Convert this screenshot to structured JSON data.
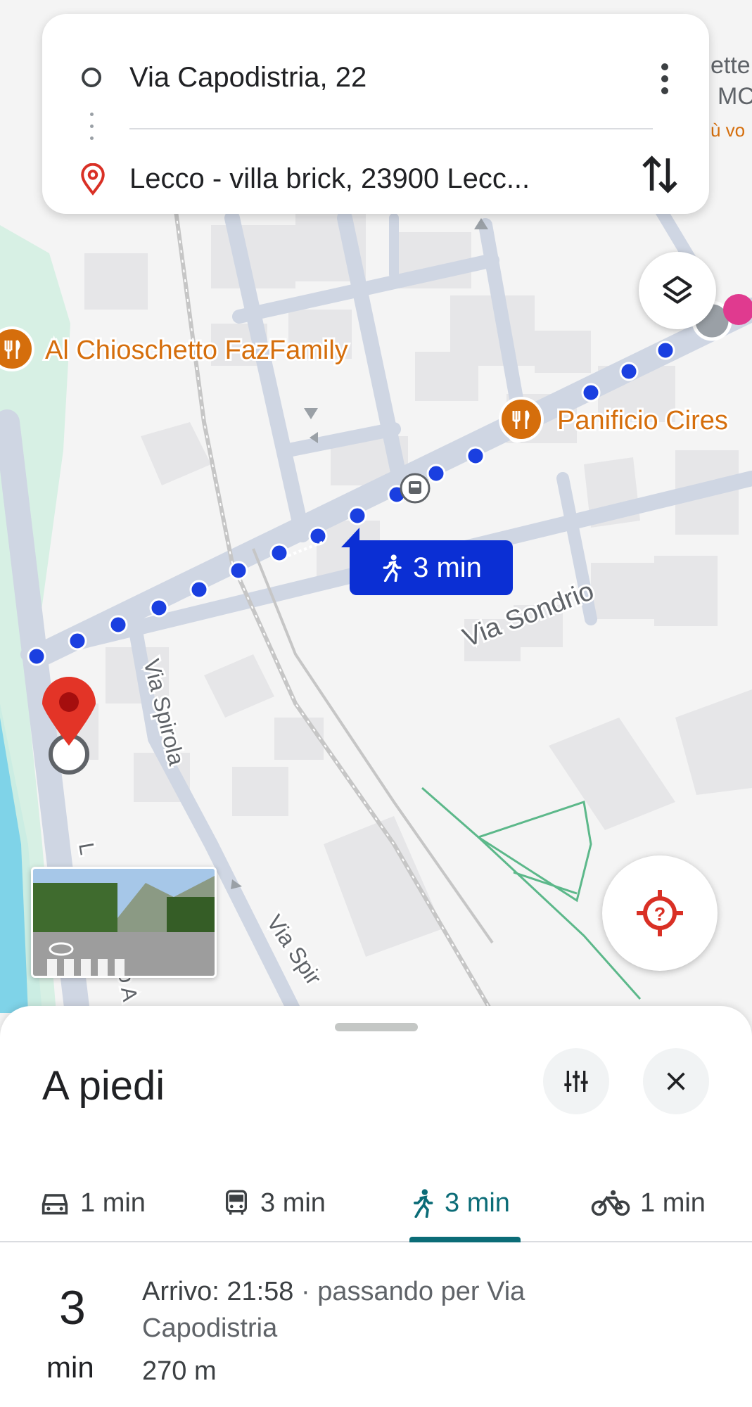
{
  "search": {
    "origin": "Via Capodistria, 22",
    "destination": "Lecco - villa brick, 23900 Lecc..."
  },
  "map": {
    "poi_chioschetto": "Al Chioschetto FazFamily",
    "poi_panificio": "Panificio Cires",
    "street_sondrio": "Via Sondrio",
    "street_spirola": "Via Spirola",
    "street_spirola_lower": "Via Spir",
    "corner_top_right": [
      "ette",
      "MC",
      "ù vo"
    ],
    "corner_left": "L",
    "corner_bottom_left": "o A",
    "route_duration": "3 min",
    "colors": {
      "route": "#1a3fe0",
      "bubble": "#0b2fd4",
      "poi": "#d56e0c",
      "pin": "#e33427",
      "park": "#d4f0e2",
      "water": "#7fd3e8"
    }
  },
  "sheet": {
    "title": "A piedi",
    "modes": [
      {
        "icon": "car-icon",
        "label": "1 min"
      },
      {
        "icon": "transit-icon",
        "label": "3 min"
      },
      {
        "icon": "walk-icon",
        "label": "3 min",
        "active": true
      },
      {
        "icon": "bike-icon",
        "label": "1 min"
      }
    ],
    "duration_value": "3",
    "duration_unit": "min",
    "arrival_text": "Arrivo: 21:58",
    "via_text": " · passando per Via Capodistria",
    "distance": "270 m",
    "accent": "#0b6c77"
  }
}
